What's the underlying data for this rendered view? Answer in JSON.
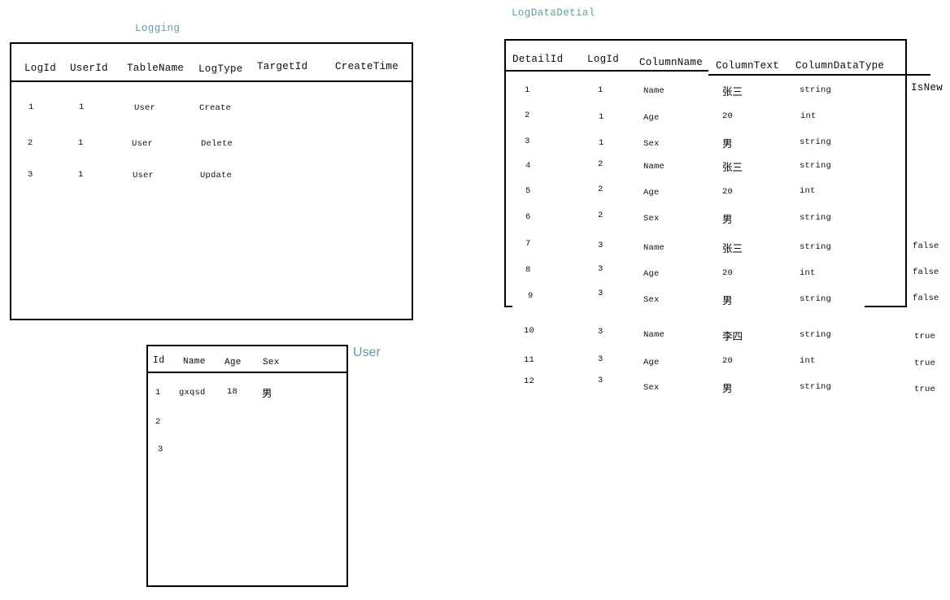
{
  "colors": {
    "title": "#5f9ea0",
    "border": "#000000",
    "text": "#101010",
    "background": "#ffffff"
  },
  "tables": {
    "logging": {
      "title": "Logging",
      "headers": [
        "LogId",
        "UserId",
        "TableName",
        "LogType",
        "TargetId",
        "CreateTime"
      ],
      "rows": [
        {
          "LogId": "1",
          "UserId": "1",
          "TableName": "User",
          "LogType": "Create",
          "TargetId": "",
          "CreateTime": ""
        },
        {
          "LogId": "2",
          "UserId": "1",
          "TableName": "User",
          "LogType": "Delete",
          "TargetId": "",
          "CreateTime": ""
        },
        {
          "LogId": "3",
          "UserId": "1",
          "TableName": "User",
          "LogType": "Update",
          "TargetId": "",
          "CreateTime": ""
        }
      ]
    },
    "log_data_detial": {
      "title": "LogDataDetial",
      "headers": [
        "DetailId",
        "LogId",
        "ColumnName",
        "ColumnText",
        "ColumnDataType",
        "IsNew"
      ],
      "rows": [
        {
          "DetailId": "1",
          "LogId": "1",
          "ColumnName": "Name",
          "ColumnText": "张三",
          "ColumnDataType": "string",
          "IsNew": ""
        },
        {
          "DetailId": "2",
          "LogId": "1",
          "ColumnName": "Age",
          "ColumnText": "20",
          "ColumnDataType": "int",
          "IsNew": ""
        },
        {
          "DetailId": "3",
          "LogId": "1",
          "ColumnName": "Sex",
          "ColumnText": "男",
          "ColumnDataType": "string",
          "IsNew": ""
        },
        {
          "DetailId": "4",
          "LogId": "2",
          "ColumnName": "Name",
          "ColumnText": "张三",
          "ColumnDataType": "string",
          "IsNew": ""
        },
        {
          "DetailId": "5",
          "LogId": "2",
          "ColumnName": "Age",
          "ColumnText": "20",
          "ColumnDataType": "int",
          "IsNew": ""
        },
        {
          "DetailId": "6",
          "LogId": "2",
          "ColumnName": "Sex",
          "ColumnText": "男",
          "ColumnDataType": "string",
          "IsNew": ""
        },
        {
          "DetailId": "7",
          "LogId": "3",
          "ColumnName": "Name",
          "ColumnText": "张三",
          "ColumnDataType": "string",
          "IsNew": "false"
        },
        {
          "DetailId": "8",
          "LogId": "3",
          "ColumnName": "Age",
          "ColumnText": "20",
          "ColumnDataType": "int",
          "IsNew": "false"
        },
        {
          "DetailId": "9",
          "LogId": "3",
          "ColumnName": "Sex",
          "ColumnText": "男",
          "ColumnDataType": "string",
          "IsNew": "false"
        },
        {
          "DetailId": "10",
          "LogId": "3",
          "ColumnName": "Name",
          "ColumnText": "李四",
          "ColumnDataType": "string",
          "IsNew": "true"
        },
        {
          "DetailId": "11",
          "LogId": "3",
          "ColumnName": "Age",
          "ColumnText": "20",
          "ColumnDataType": "int",
          "IsNew": "true"
        },
        {
          "DetailId": "12",
          "LogId": "3",
          "ColumnName": "Sex",
          "ColumnText": "男",
          "ColumnDataType": "string",
          "IsNew": "true"
        }
      ]
    },
    "user": {
      "title": "User",
      "headers": [
        "Id",
        "Name",
        "Age",
        "Sex"
      ],
      "rows": [
        {
          "Id": "1",
          "Name": "gxqsd",
          "Age": "18",
          "Sex": "男"
        },
        {
          "Id": "2",
          "Name": "",
          "Age": "",
          "Sex": ""
        },
        {
          "Id": "3",
          "Name": "",
          "Age": "",
          "Sex": ""
        }
      ]
    }
  }
}
